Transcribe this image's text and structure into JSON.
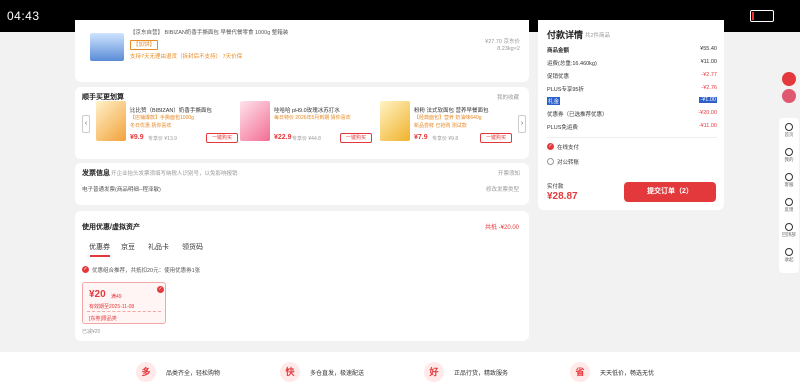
{
  "status": {
    "time": "04:43"
  },
  "product": {
    "title": "【京东自营】 BIBIZAN奶香手撕面包 早餐代餐零食 1000g 整箱装",
    "addon_tag": "【加饼】",
    "service": "支持7天无理由退货（拆封后不支持）  7天价保",
    "price_now": "¥27.70 京东价",
    "weight": "8.23kg×2"
  },
  "reco": {
    "title": "顺手买更划算",
    "side_link": "我的收藏",
    "items": [
      {
        "name": "比比赞（BIBIZAN）奶香手撕面包",
        "desc": "【店铺爆款】手撕面包1000g",
        "badge": "冬日优惠 猜你喜欢",
        "price": "¥9.9",
        "plus": "专享价 ¥13.9",
        "buy": "一键购买"
      },
      {
        "name": "哇哈哈 pH9.0玫瑰冰苏打水",
        "desc": "每日特价 2026年5月到期 猜你喜欢",
        "badge": "",
        "price": "¥22.9",
        "plus": "专享价 ¥44.8",
        "buy": "一键购买"
      },
      {
        "name": "粉粉 法式软面包 营养早餐面包",
        "desc": "【经典面包】营养 奶油味640g",
        "badge": "新品尝鲜 已抢购 测试款",
        "price": "¥7.9",
        "plus": "专享价 ¥9.8",
        "buy": "一键购买"
      }
    ]
  },
  "invoice": {
    "title": "发票信息",
    "note": "开企业抬头发票须填写纳税人识别号，以免影响报销",
    "right": "开票须知",
    "value": "电子普通发票(商品明细--程泽敏)",
    "modify": "修改发票类型"
  },
  "coupons": {
    "title": "使用优惠/虚拟资产",
    "saving": "共抵 -¥20.00",
    "tabs": [
      "优惠券",
      "京豆",
      "礼品卡",
      "领货码"
    ],
    "tip": "优惠组合推荐，共抵扣20元：使用优惠券1张",
    "coupon_amount": "¥20",
    "coupon_cond": "满49",
    "coupon_valid": "有效期至2025-11-08",
    "coupon_scope": "[东券]限品类",
    "used": "已减¥20"
  },
  "summary": {
    "title": "付款详情",
    "count": "共2件商品",
    "rows": [
      {
        "label": "商品金额",
        "value": "¥55.40",
        "red": false
      },
      {
        "label": "运费(总重:16.460kg)",
        "value": "¥11.00",
        "red": false
      },
      {
        "label": "促销优惠",
        "value": "-¥2.77",
        "red": true
      },
      {
        "label": "PLUS专享95折",
        "value": "-¥2.76",
        "red": true
      },
      {
        "label": "礼金",
        "value": "-¥1.00",
        "red": true
      },
      {
        "label": "优惠券（已选推荐优惠）",
        "value": "-¥20.00",
        "red": true
      },
      {
        "label": "PLUS免运费",
        "value": "-¥11.00",
        "red": true
      }
    ],
    "pay_online": "在线支付",
    "pay_corp": "对公转账",
    "total_label": "实付款",
    "total": "¥28.87",
    "submit": "提交订单（2）"
  },
  "sidebar": {
    "items": [
      "首页",
      "我的",
      "客服",
      "反馈",
      "回顶部",
      "收起"
    ]
  },
  "footer": {
    "items": [
      {
        "badge": "多",
        "text": "品类齐全，轻松购物"
      },
      {
        "badge": "快",
        "text": "多仓直发，极速配送"
      },
      {
        "badge": "好",
        "text": "正品行货，精致服务"
      },
      {
        "badge": "省",
        "text": "天天低价，畅选无忧"
      }
    ]
  },
  "colors": {
    "accent": "#e4393c",
    "warning": "#e88a26",
    "background": "#f2f2f2"
  }
}
